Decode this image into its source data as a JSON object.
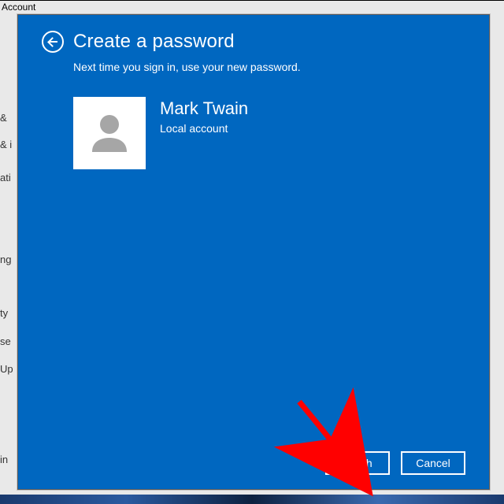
{
  "background": {
    "page_title": "Account",
    "left_items": [
      "&",
      "& i",
      "ati",
      "ng",
      "ty",
      "se",
      "Up",
      "in"
    ]
  },
  "dialog": {
    "title": "Create a password",
    "subtitle": "Next time you sign in, use your new password.",
    "user": {
      "name": "Mark Twain",
      "type": "Local account"
    },
    "buttons": {
      "finish": "Finish",
      "cancel": "Cancel"
    }
  },
  "colors": {
    "modal_bg": "#0067c0",
    "annotation": "#ff0000"
  }
}
